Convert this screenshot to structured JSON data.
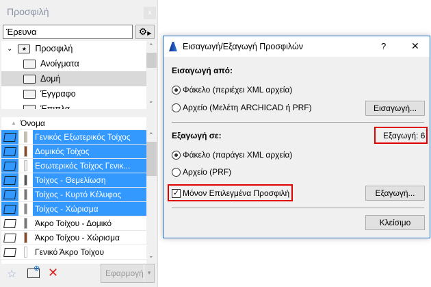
{
  "panel": {
    "title": "Προσφιλή",
    "close": "x",
    "search_value": "Έρευνα",
    "tree": [
      {
        "label": "Προσφιλή",
        "root": true
      },
      {
        "label": "Ανοίγματα"
      },
      {
        "label": "Δομή",
        "selected": true
      },
      {
        "label": "Έγγραφο"
      },
      {
        "label": "Έπιπλα"
      }
    ],
    "column_header": "Όνομα",
    "items": [
      {
        "label": "Γενικός Εξωτερικός Τοίχος",
        "selected": true,
        "color": "#c9c3a8"
      },
      {
        "label": "Δομικός Τοίχος",
        "selected": true,
        "color": "#8b4a22"
      },
      {
        "label": "Εσωτερικός Τοίχος Γενικ...",
        "selected": true,
        "color": "#eeeeee"
      },
      {
        "label": "Τοίχος - Θεμελίωση",
        "selected": true,
        "color": "#555555"
      },
      {
        "label": "Τοίχος - Κυρτό Κέλυφος",
        "selected": true,
        "color": "#777777"
      },
      {
        "label": "Τοίχος - Χώρισμα",
        "selected": true,
        "color": "#8a8a8a"
      },
      {
        "label": "Άκρο Τοίχου - Δομικό",
        "selected": false,
        "color": "#777777"
      },
      {
        "label": "Άκρο Τοίχου - Χώρισμα",
        "selected": false,
        "color": "#8b4a22"
      },
      {
        "label": "Γενικό Άκρο Τοίχου",
        "selected": false,
        "color": "#ffffff"
      }
    ],
    "apply_label": "Εφαρμογή"
  },
  "dialog": {
    "title": "Εισαγωγή/Εξαγωγή Προσφιλών",
    "help": "?",
    "close": "✕",
    "import_heading": "Εισαγωγή από:",
    "import_opt1": "Φάκελο (περιέχει XML αρχεία)",
    "import_opt2": "Αρχείο (Μελέτη ARCHICAD ή PRF)",
    "import_button": "Εισαγωγή...",
    "export_heading": "Εξαγωγή σε:",
    "export_count": "Εξαγωγή: 6",
    "export_opt1": "Φάκελο (παράγει XML αρχεία)",
    "export_opt2": "Αρχείο (PRF)",
    "only_selected": "Μόνον Επιλεγμένα Προσφιλή",
    "export_button": "Εξαγωγή...",
    "close_button": "Κλείσιμο"
  },
  "colors": {
    "selection": "#3399ff",
    "highlight": "#e00000"
  }
}
